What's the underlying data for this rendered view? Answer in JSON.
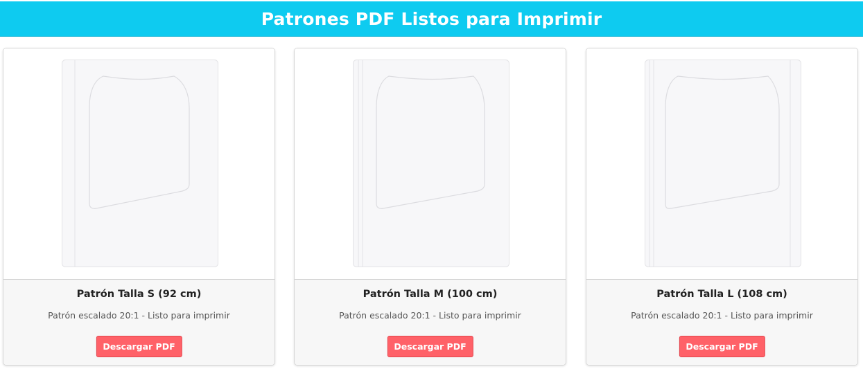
{
  "header": {
    "title": "Patrones PDF Listos para Imprimir",
    "background_color": "#0ecbf0"
  },
  "cards": [
    {
      "title": "Patrón Talla S (92 cm)",
      "description": "Patrón escalado 20:1 - Listo para imprimir",
      "button_label": "Descargar PDF",
      "preview_icon": "pattern-preview-icon"
    },
    {
      "title": "Patrón Talla M (100 cm)",
      "description": "Patrón escalado 20:1 - Listo para imprimir",
      "button_label": "Descargar PDF",
      "preview_icon": "pattern-preview-icon"
    },
    {
      "title": "Patrón Talla L (108 cm)",
      "description": "Patrón escalado 20:1 - Listo para imprimir",
      "button_label": "Descargar PDF",
      "preview_icon": "pattern-preview-icon"
    }
  ],
  "colors": {
    "button": "#ff6168",
    "footer_background": "#f7f7f7"
  }
}
